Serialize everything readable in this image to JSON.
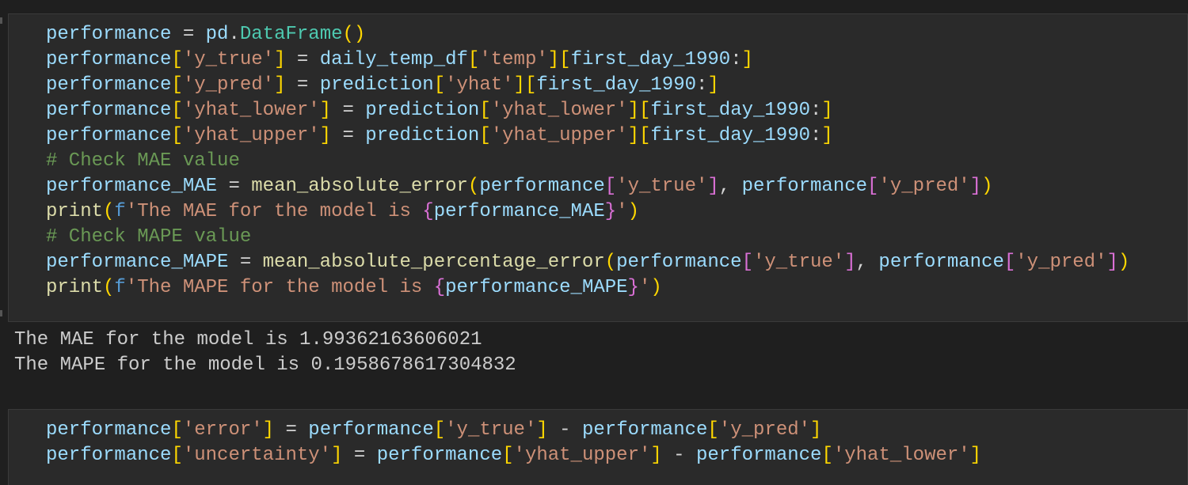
{
  "cells": [
    {
      "lines": [
        [
          [
            "var",
            "performance"
          ],
          [
            "op",
            " = "
          ],
          [
            "var",
            "pd"
          ],
          [
            "op",
            "."
          ],
          [
            "cls",
            "DataFrame"
          ],
          [
            "b1",
            "()"
          ]
        ],
        [
          [
            "var",
            "performance"
          ],
          [
            "b1",
            "["
          ],
          [
            "str",
            "'y_true'"
          ],
          [
            "b1",
            "]"
          ],
          [
            "op",
            " = "
          ],
          [
            "var",
            "daily_temp_df"
          ],
          [
            "b1",
            "["
          ],
          [
            "str",
            "'temp'"
          ],
          [
            "b1",
            "]["
          ],
          [
            "var",
            "first_day_1990"
          ],
          [
            "op",
            ":"
          ],
          [
            "b1",
            "]"
          ]
        ],
        [
          [
            "var",
            "performance"
          ],
          [
            "b1",
            "["
          ],
          [
            "str",
            "'y_pred'"
          ],
          [
            "b1",
            "]"
          ],
          [
            "op",
            " = "
          ],
          [
            "var",
            "prediction"
          ],
          [
            "b1",
            "["
          ],
          [
            "str",
            "'yhat'"
          ],
          [
            "b1",
            "]["
          ],
          [
            "var",
            "first_day_1990"
          ],
          [
            "op",
            ":"
          ],
          [
            "b1",
            "]"
          ]
        ],
        [
          [
            "var",
            "performance"
          ],
          [
            "b1",
            "["
          ],
          [
            "str",
            "'yhat_lower'"
          ],
          [
            "b1",
            "]"
          ],
          [
            "op",
            " = "
          ],
          [
            "var",
            "prediction"
          ],
          [
            "b1",
            "["
          ],
          [
            "str",
            "'yhat_lower'"
          ],
          [
            "b1",
            "]["
          ],
          [
            "var",
            "first_day_1990"
          ],
          [
            "op",
            ":"
          ],
          [
            "b1",
            "]"
          ]
        ],
        [
          [
            "var",
            "performance"
          ],
          [
            "b1",
            "["
          ],
          [
            "str",
            "'yhat_upper'"
          ],
          [
            "b1",
            "]"
          ],
          [
            "op",
            " = "
          ],
          [
            "var",
            "prediction"
          ],
          [
            "b1",
            "["
          ],
          [
            "str",
            "'yhat_upper'"
          ],
          [
            "b1",
            "]["
          ],
          [
            "var",
            "first_day_1990"
          ],
          [
            "op",
            ":"
          ],
          [
            "b1",
            "]"
          ]
        ],
        [
          [
            "cmt",
            "# Check MAE value"
          ]
        ],
        [
          [
            "var",
            "performance_MAE"
          ],
          [
            "op",
            " = "
          ],
          [
            "fn",
            "mean_absolute_error"
          ],
          [
            "b1",
            "("
          ],
          [
            "var",
            "performance"
          ],
          [
            "b2",
            "["
          ],
          [
            "str",
            "'y_true'"
          ],
          [
            "b2",
            "]"
          ],
          [
            "op",
            ", "
          ],
          [
            "var",
            "performance"
          ],
          [
            "b2",
            "["
          ],
          [
            "str",
            "'y_pred'"
          ],
          [
            "b2",
            "]"
          ],
          [
            "b1",
            ")"
          ]
        ],
        [
          [
            "fn",
            "print"
          ],
          [
            "b1",
            "("
          ],
          [
            "kw",
            "f"
          ],
          [
            "str",
            "'The MAE for the model is "
          ],
          [
            "b2",
            "{"
          ],
          [
            "var",
            "performance_MAE"
          ],
          [
            "b2",
            "}"
          ],
          [
            "str",
            "'"
          ],
          [
            "b1",
            ")"
          ]
        ],
        [
          [
            "cmt",
            "# Check MAPE value"
          ]
        ],
        [
          [
            "var",
            "performance_MAPE"
          ],
          [
            "op",
            " = "
          ],
          [
            "fn",
            "mean_absolute_percentage_error"
          ],
          [
            "b1",
            "("
          ],
          [
            "var",
            "performance"
          ],
          [
            "b2",
            "["
          ],
          [
            "str",
            "'y_true'"
          ],
          [
            "b2",
            "]"
          ],
          [
            "op",
            ", "
          ],
          [
            "var",
            "performance"
          ],
          [
            "b2",
            "["
          ],
          [
            "str",
            "'y_pred'"
          ],
          [
            "b2",
            "]"
          ],
          [
            "b1",
            ")"
          ]
        ],
        [
          [
            "fn",
            "print"
          ],
          [
            "b1",
            "("
          ],
          [
            "kw",
            "f"
          ],
          [
            "str",
            "'The MAPE for the model is "
          ],
          [
            "b2",
            "{"
          ],
          [
            "var",
            "performance_MAPE"
          ],
          [
            "b2",
            "}"
          ],
          [
            "str",
            "'"
          ],
          [
            "b1",
            ")"
          ]
        ]
      ]
    },
    {
      "lines": [
        [
          [
            "var",
            "performance"
          ],
          [
            "b1",
            "["
          ],
          [
            "str",
            "'error'"
          ],
          [
            "b1",
            "]"
          ],
          [
            "op",
            " = "
          ],
          [
            "var",
            "performance"
          ],
          [
            "b1",
            "["
          ],
          [
            "str",
            "'y_true'"
          ],
          [
            "b1",
            "]"
          ],
          [
            "op",
            " - "
          ],
          [
            "var",
            "performance"
          ],
          [
            "b1",
            "["
          ],
          [
            "str",
            "'y_pred'"
          ],
          [
            "b1",
            "]"
          ]
        ],
        [
          [
            "var",
            "performance"
          ],
          [
            "b1",
            "["
          ],
          [
            "str",
            "'uncertainty'"
          ],
          [
            "b1",
            "]"
          ],
          [
            "op",
            " = "
          ],
          [
            "var",
            "performance"
          ],
          [
            "b1",
            "["
          ],
          [
            "str",
            "'yhat_upper'"
          ],
          [
            "b1",
            "]"
          ],
          [
            "op",
            " - "
          ],
          [
            "var",
            "performance"
          ],
          [
            "b1",
            "["
          ],
          [
            "str",
            "'yhat_lower'"
          ],
          [
            "b1",
            "]"
          ]
        ]
      ]
    }
  ],
  "output": {
    "lines": [
      "The MAE for the model is 1.99362163606021",
      "The MAPE for the model is 0.1958678617304832"
    ]
  }
}
